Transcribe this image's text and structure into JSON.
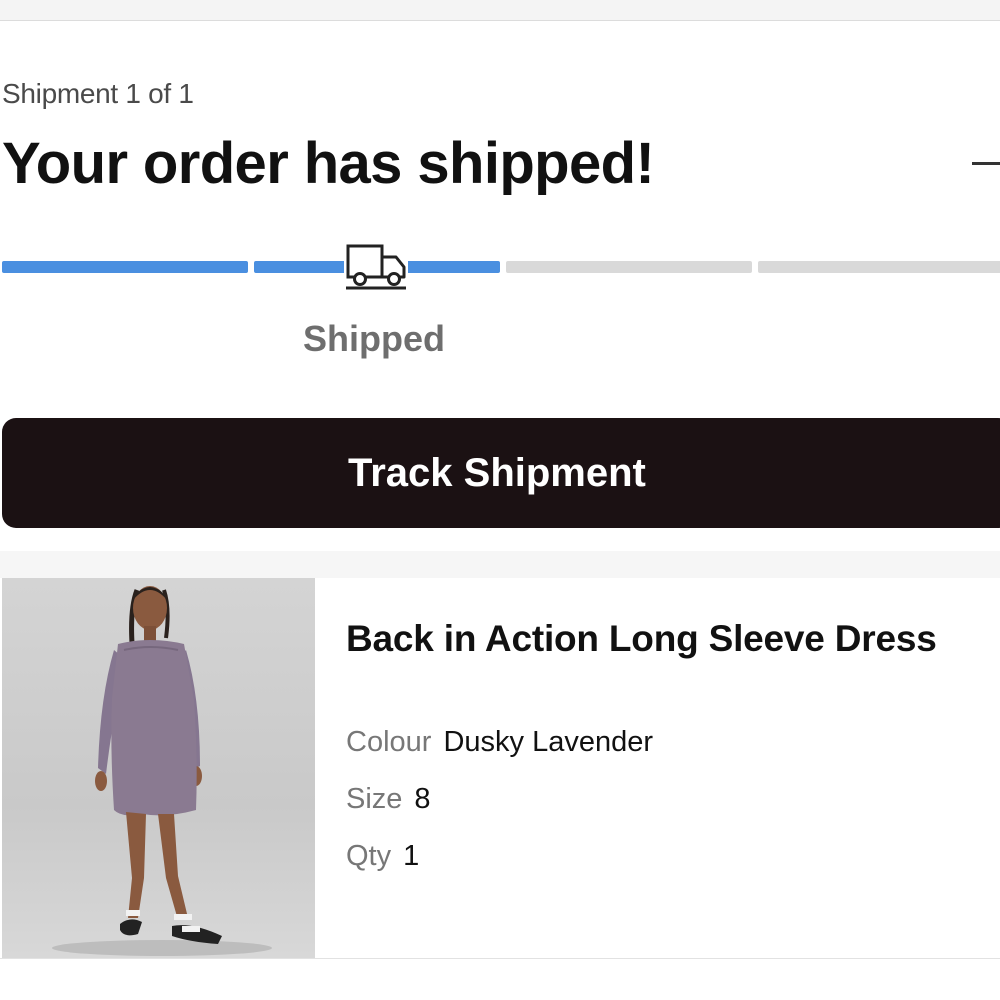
{
  "shipment": {
    "count_label": "Shipment 1 of 1",
    "title": "Your order has shipped!",
    "status_label": "Shipped",
    "progress_segments": [
      {
        "state": "complete"
      },
      {
        "state": "complete"
      },
      {
        "state": "pending"
      },
      {
        "state": "pending"
      }
    ],
    "status_icon": "truck-icon",
    "collapse_icon": "minus-icon"
  },
  "track_button": {
    "label": "Track Shipment"
  },
  "item": {
    "name": "Back in Action Long Sleeve Dress",
    "image": "product-photo-dress",
    "attributes": [
      {
        "key": "Colour",
        "value": "Dusky Lavender"
      },
      {
        "key": "Size",
        "value": "8"
      },
      {
        "key": "Qty",
        "value": "1"
      }
    ]
  },
  "colors": {
    "progress_complete": "#4a8fe0",
    "progress_pending": "#d9d9d9",
    "button_bg": "#1b1113",
    "dress": "#8a7a91"
  }
}
